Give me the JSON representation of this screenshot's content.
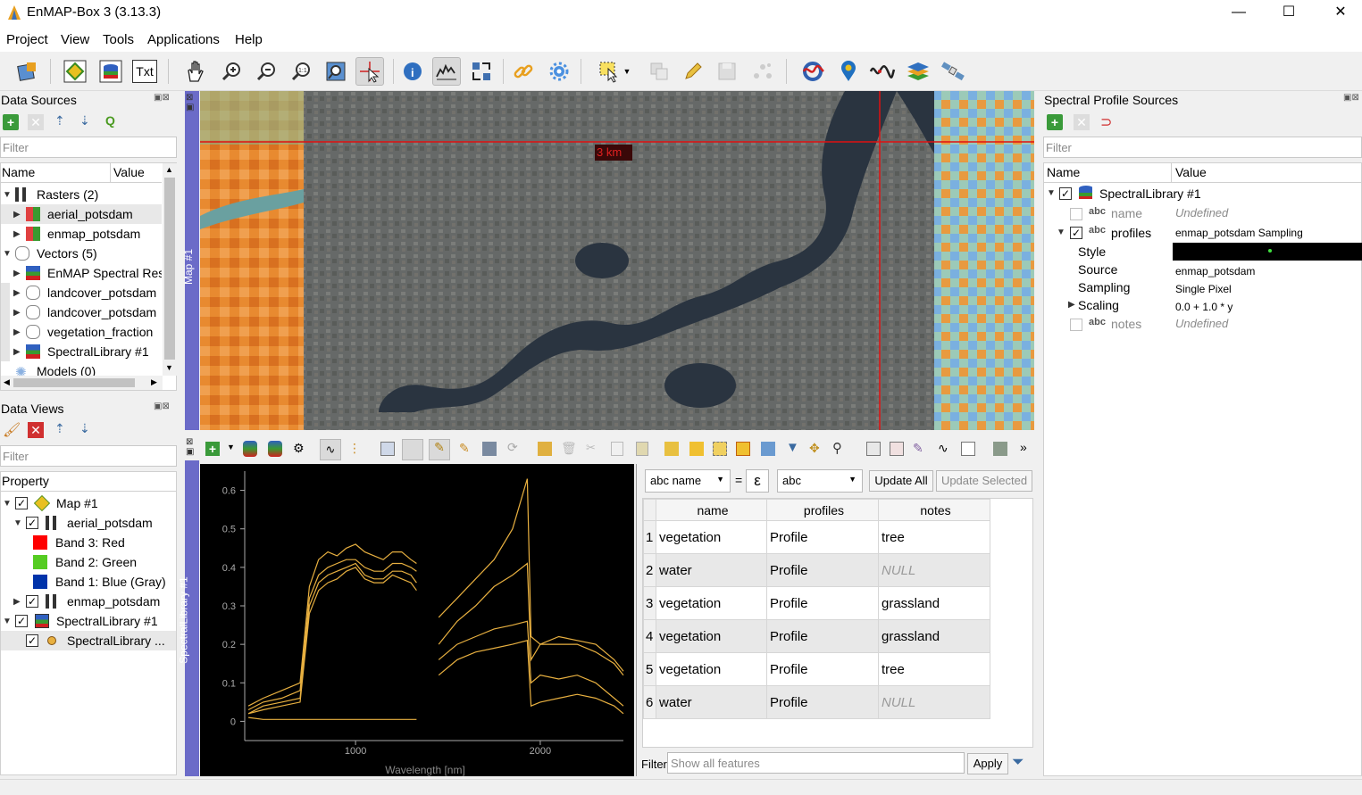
{
  "window": {
    "title": "EnMAP-Box 3 (3.13.3)",
    "minimize": "—",
    "maximize": "☐",
    "close": "✕"
  },
  "menu": [
    "Project",
    "View",
    "Tools",
    "Applications",
    "Help"
  ],
  "toolbar": {
    "icons": [
      "add-project-icon",
      "raster-view-icon",
      "layers-view-icon",
      "text-view-icon",
      "pan-icon",
      "zoom-in-icon",
      "zoom-out-icon",
      "zoom-actual-icon",
      "zoom-full-icon",
      "select-location-icon",
      "identify-icon",
      "spectral-profile-icon",
      "swipe-icon",
      "link-icon",
      "settings-icon",
      "select-features-icon",
      "deselect-icon",
      "edit-icon",
      "save-edits-icon",
      "digitize-icon",
      "processing-icon",
      "location-icon",
      "spectral-line-icon",
      "stack-icon",
      "satellite-icon"
    ],
    "text_button_label": "Txt"
  },
  "data_sources": {
    "title": "Data Sources",
    "filter_placeholder": "Filter",
    "columns": [
      "Name",
      "Value"
    ],
    "items": [
      {
        "label": "Rasters (2)",
        "level": 0,
        "expanded": true,
        "icon": "raster-group-icon"
      },
      {
        "label": "aerial_potsdam",
        "level": 1,
        "icon": "raster-icon"
      },
      {
        "label": "enmap_potsdam",
        "level": 1,
        "icon": "raster-icon"
      },
      {
        "label": "Vectors (5)",
        "level": 0,
        "expanded": true,
        "icon": "vector-group-icon"
      },
      {
        "label": "EnMAP Spectral Res",
        "level": 1,
        "icon": "spectral-library-icon"
      },
      {
        "label": "landcover_potsdam",
        "level": 1,
        "icon": "polygon-icon"
      },
      {
        "label": "landcover_potsdam",
        "level": 1,
        "icon": "polygon-icon"
      },
      {
        "label": "vegetation_fraction",
        "level": 1,
        "icon": "polygon-icon"
      },
      {
        "label": "SpectralLibrary #1",
        "level": 1,
        "icon": "spectral-library-icon"
      },
      {
        "label": "Models (0)",
        "level": 0,
        "icon": "model-icon"
      }
    ]
  },
  "data_views": {
    "title": "Data Views",
    "filter_placeholder": "Filter",
    "column": "Property",
    "items": [
      {
        "label": "Map #1",
        "level": 0,
        "checked": true
      },
      {
        "label": "aerial_potsdam",
        "level": 1,
        "checked": true
      },
      {
        "label": "Band 3: Red",
        "level": 2,
        "color": "#ff0000"
      },
      {
        "label": "Band 2: Green",
        "level": 2,
        "color": "#55cc22"
      },
      {
        "label": "Band 1: Blue (Gray)",
        "level": 2,
        "color": "#0033aa"
      },
      {
        "label": "enmap_potsdam",
        "level": 1,
        "checked": true
      },
      {
        "label": "SpectralLibrary #1",
        "level": 0,
        "checked": true
      },
      {
        "label": "SpectralLibrary ...",
        "level": 1,
        "checked": true
      }
    ]
  },
  "map": {
    "tab_label": "Map #1",
    "scale_label": "3 km"
  },
  "spectral_library": {
    "tab_label": "SpectralLibrary #1",
    "field_select": "abc name",
    "equals": "=",
    "epsilon": "ε",
    "value_select": "abc",
    "update_all": "Update All",
    "update_selected": "Update Selected",
    "columns": [
      "name",
      "profiles",
      "notes"
    ],
    "rows": [
      {
        "id": "1",
        "name": "vegetation",
        "profiles": "Profile",
        "notes": "tree"
      },
      {
        "id": "2",
        "name": "water",
        "profiles": "Profile",
        "notes": "NULL"
      },
      {
        "id": "3",
        "name": "vegetation",
        "profiles": "Profile",
        "notes": "grassland"
      },
      {
        "id": "4",
        "name": "vegetation",
        "profiles": "Profile",
        "notes": "grassland"
      },
      {
        "id": "5",
        "name": "vegetation",
        "profiles": "Profile",
        "notes": "tree"
      },
      {
        "id": "6",
        "name": "water",
        "profiles": "Profile",
        "notes": "NULL"
      }
    ],
    "filter_label": "Filter",
    "filter_placeholder": "Show all features",
    "apply": "Apply"
  },
  "chart_data": {
    "type": "line",
    "xlabel": "Wavelength [nm]",
    "ylabel": "",
    "xlim": [
      400,
      2450
    ],
    "ylim": [
      -0.05,
      0.65
    ],
    "xticks": [
      1000,
      2000
    ],
    "yticks": [
      0,
      0.1,
      0.2,
      0.3,
      0.4,
      0.5,
      0.6
    ],
    "line_color": "#e8b040",
    "series": [
      {
        "x": [
          420,
          500,
          600,
          700,
          750,
          800,
          850,
          900,
          950,
          1000,
          1050,
          1100,
          1150,
          1200,
          1250,
          1300,
          1330
        ],
        "values": [
          0.04,
          0.06,
          0.08,
          0.1,
          0.35,
          0.42,
          0.44,
          0.43,
          0.45,
          0.46,
          0.44,
          0.43,
          0.42,
          0.44,
          0.44,
          0.42,
          0.41
        ]
      },
      {
        "x": [
          420,
          500,
          600,
          700,
          750,
          800,
          850,
          900,
          950,
          1000,
          1050,
          1100,
          1150,
          1200,
          1250,
          1300,
          1330
        ],
        "values": [
          0.03,
          0.05,
          0.06,
          0.08,
          0.32,
          0.38,
          0.4,
          0.41,
          0.42,
          0.42,
          0.4,
          0.39,
          0.39,
          0.41,
          0.41,
          0.4,
          0.39
        ]
      },
      {
        "x": [
          420,
          500,
          600,
          700,
          750,
          800,
          850,
          900,
          950,
          1000,
          1050,
          1100,
          1150,
          1200,
          1250,
          1300,
          1330
        ],
        "values": [
          0.02,
          0.04,
          0.05,
          0.06,
          0.3,
          0.36,
          0.38,
          0.39,
          0.4,
          0.41,
          0.38,
          0.37,
          0.37,
          0.39,
          0.39,
          0.38,
          0.36
        ]
      },
      {
        "x": [
          420,
          500,
          600,
          700,
          750,
          800,
          850,
          900,
          950,
          1000,
          1050,
          1100,
          1150,
          1200,
          1250,
          1300,
          1330
        ],
        "values": [
          0.02,
          0.03,
          0.04,
          0.05,
          0.28,
          0.34,
          0.36,
          0.37,
          0.39,
          0.4,
          0.37,
          0.36,
          0.36,
          0.38,
          0.37,
          0.36,
          0.34
        ]
      },
      {
        "x": [
          420,
          500,
          600,
          700,
          750,
          800,
          900,
          1000,
          1100,
          1200,
          1330
        ],
        "values": [
          0.01,
          0.005,
          0.005,
          0.005,
          0.005,
          0.005,
          0.005,
          0.005,
          0.005,
          0.005,
          0.005
        ]
      },
      {
        "x": [
          1450,
          1550,
          1650,
          1750,
          1850,
          1930,
          1950,
          2000,
          2100,
          2200,
          2300,
          2400,
          2450
        ],
        "values": [
          0.27,
          0.32,
          0.37,
          0.42,
          0.5,
          0.63,
          0.22,
          0.2,
          0.22,
          0.21,
          0.2,
          0.16,
          0.13
        ]
      },
      {
        "x": [
          1450,
          1550,
          1650,
          1750,
          1850,
          1930,
          1950,
          2000,
          2100,
          2200,
          2300,
          2400,
          2450
        ],
        "values": [
          0.2,
          0.26,
          0.3,
          0.35,
          0.38,
          0.41,
          0.16,
          0.2,
          0.2,
          0.2,
          0.18,
          0.15,
          0.12
        ]
      },
      {
        "x": [
          1450,
          1550,
          1650,
          1750,
          1850,
          1930,
          1950,
          2000,
          2100,
          2200,
          2300,
          2400,
          2450
        ],
        "values": [
          0.16,
          0.2,
          0.22,
          0.24,
          0.25,
          0.26,
          0.1,
          0.12,
          0.11,
          0.12,
          0.1,
          0.06,
          0.04
        ]
      },
      {
        "x": [
          1450,
          1550,
          1650,
          1750,
          1850,
          1930,
          1950,
          2000,
          2100,
          2200,
          2300,
          2400,
          2450
        ],
        "values": [
          0.12,
          0.16,
          0.18,
          0.19,
          0.2,
          0.21,
          0.04,
          0.05,
          0.06,
          0.07,
          0.06,
          0.04,
          0.02
        ]
      }
    ]
  },
  "profile_sources": {
    "title": "Spectral Profile Sources",
    "filter_placeholder": "Filter",
    "columns": [
      "Name",
      "Value"
    ],
    "items": [
      {
        "label": "SpectralLibrary #1",
        "value": ""
      },
      {
        "label": "name",
        "value": "Undefined"
      },
      {
        "label": "profiles",
        "value": "enmap_potsdam Sampling"
      },
      {
        "label": "Style",
        "value": ""
      },
      {
        "label": "Source",
        "value": "enmap_potsdam"
      },
      {
        "label": "Sampling",
        "value": "Single Pixel"
      },
      {
        "label": "Scaling",
        "value": "0.0 + 1.0 * y"
      },
      {
        "label": "notes",
        "value": "Undefined"
      }
    ],
    "abc": "abc"
  }
}
